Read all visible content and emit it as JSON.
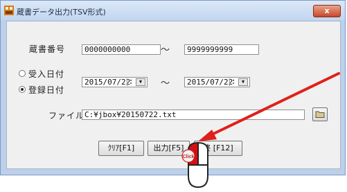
{
  "window": {
    "title": "蔵書データ出力(TSV形式)",
    "close_label": "x"
  },
  "form": {
    "book_number_label": "蔵書番号",
    "book_number_from": "0000000000",
    "book_number_to": "9999999999",
    "range_separator": "～",
    "received_date_label": "受入日付",
    "registered_date_label": "登録日付",
    "date_from": "2015/07/22",
    "date_to": "2015/07/22",
    "selected_date_type": "登録日付",
    "file_name_label": "ファイル名",
    "file_name_value": "C:¥jbox¥20150722.txt"
  },
  "buttons": {
    "clear_label": "ｸﾘｱ[F1]",
    "output_label": "出力[F5]",
    "close_label_partial": "終",
    "close_key": "[F12]"
  },
  "overlay": {
    "click_badge": "Click",
    "arrow_color": "#e0201b"
  }
}
